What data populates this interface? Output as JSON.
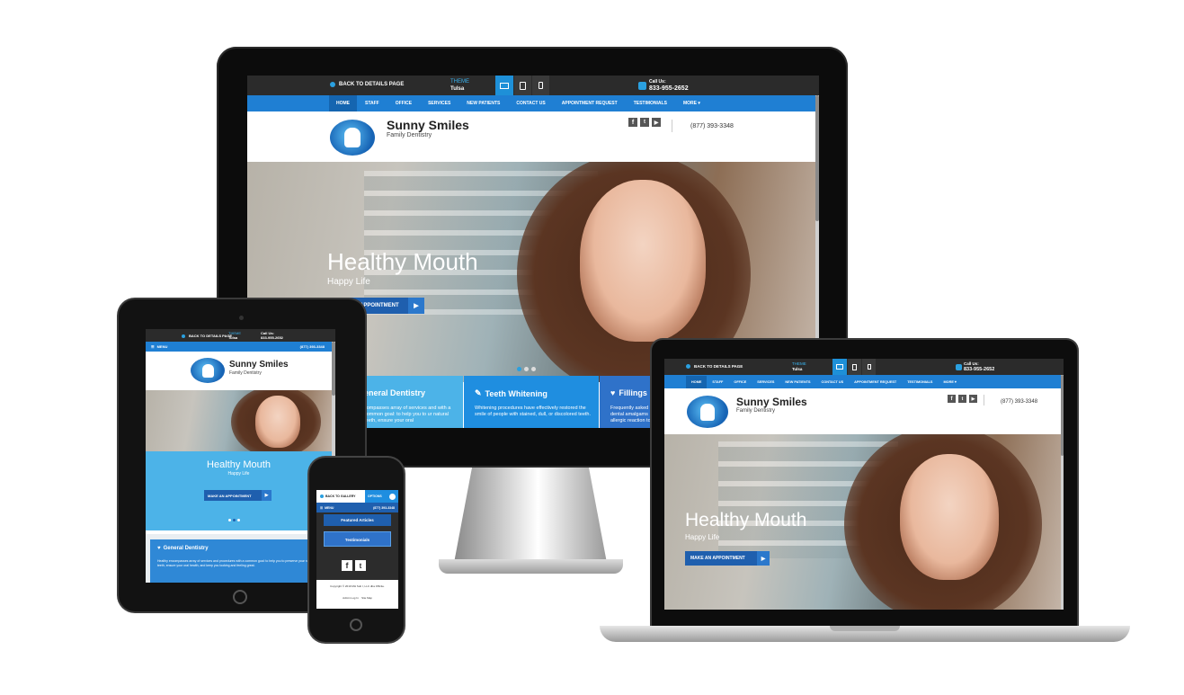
{
  "top_bar": {
    "back_label": "BACK TO DETAILS PAGE",
    "theme_label": "THEME",
    "theme_value": "Tulsa",
    "call_label": "Call Us:",
    "call_number": "833-955-2652"
  },
  "nav": {
    "items": [
      "HOME",
      "STAFF",
      "OFFICE",
      "SERVICES",
      "NEW PATIENTS",
      "CONTACT US",
      "APPOINTMENT REQUEST",
      "TESTIMONIALS",
      "MORE ▾"
    ]
  },
  "brand": {
    "name": "Sunny Smiles",
    "subtitle": "Family Dentistry",
    "phone": "(877) 393-3348"
  },
  "hero": {
    "title": "Healthy Mouth",
    "subtitle": "Happy Life",
    "cta": "MAKE AN APPOINTMENT",
    "cta_partial": "APPOINTMENT"
  },
  "services": [
    {
      "title": "General Dentistry",
      "title_partial": "eneral Dentistry",
      "text": "compasses array of services and with a common goal: to help you to ur natural teeth, ensure your oral"
    },
    {
      "title": "Teeth Whitening",
      "text": "Whitening procedures have effectively restored the smile of people with stained, dull, or discolored teeth."
    },
    {
      "title": "Fillings",
      "text": "Frequently asked dental amalgams allergic reaction to"
    }
  ],
  "tablet": {
    "menu": "MENU",
    "phone": "(877) 393-3348",
    "service_title": "General Dentistry",
    "service_text": "Healthy encompasses array of services and procedures with a common goal: to help you to preserve your natural teeth, ensure your oral health, and keep you looking and feeling great."
  },
  "phone": {
    "back_label": "BACK TO GALLERY",
    "options_label": "OPTIONS",
    "menu": "MENU",
    "phone": "(877) 393-3348",
    "featured": "Featured Articles",
    "testimonials": "Testimonials",
    "copyright": "Copyright © 2019 MH Sub I, LLC dba Officite.",
    "admin_links": "Admin Log In    Site Map"
  },
  "icons": [
    "monitor-icon",
    "tablet-icon",
    "phone-icon",
    "facebook-icon",
    "twitter-icon",
    "youtube-icon",
    "back-dot-icon",
    "tooth-logo-icon",
    "arrow-right-icon",
    "menu-icon"
  ],
  "colors": {
    "nav_blue": "#1f7fd3",
    "top_bar": "#2b2b2b",
    "service_light": "#4cb3e8",
    "service_mid": "#1f8ee0",
    "service_dark": "#2f72c9",
    "cta": "#1f5fae"
  }
}
